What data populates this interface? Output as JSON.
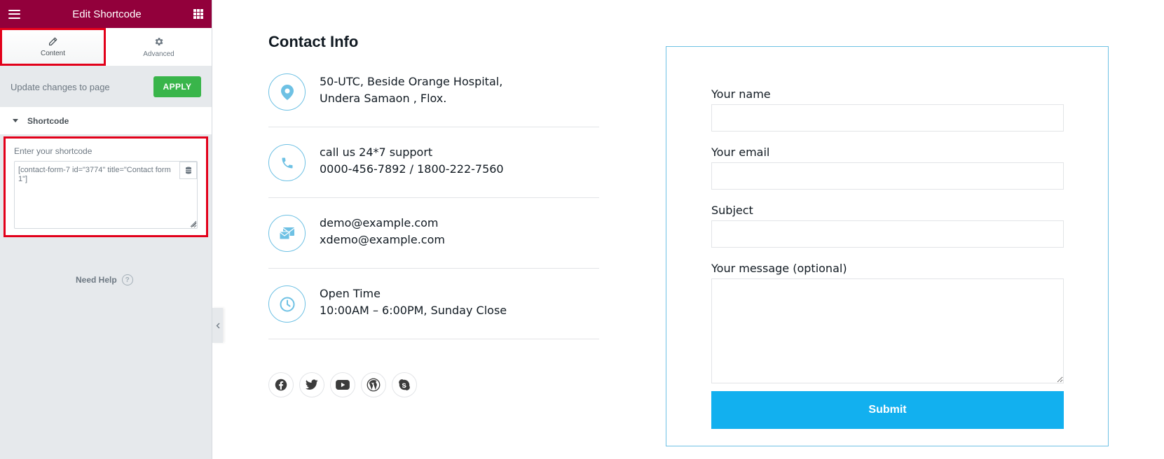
{
  "sidebar": {
    "header_title": "Edit Shortcode",
    "tabs": [
      {
        "label": "Content"
      },
      {
        "label": "Advanced"
      }
    ],
    "apply_text": "Update changes to page",
    "apply_label": "APPLY",
    "section_title": "Shortcode",
    "control_label": "Enter your shortcode",
    "shortcode_value": "[contact-form-7 id=\"3774\" title=\"Contact form 1\"]",
    "need_help": "Need Help",
    "help_glyph": "?"
  },
  "contact": {
    "title": "Contact Info",
    "items": [
      {
        "icon": "map-pin-icon",
        "line1": "50-UTC, Beside Orange Hospital,",
        "line2": "Undera Samaon , Flox."
      },
      {
        "icon": "phone-icon",
        "line1": "call us 24*7 support",
        "line2": "0000-456-7892 / 1800-222-7560"
      },
      {
        "icon": "envelope-icon",
        "line1": "demo@example.com",
        "line2": "xdemo@example.com"
      },
      {
        "icon": "clock-icon",
        "line1": "Open Time",
        "line2": "10:00AM – 6:00PM, Sunday Close"
      }
    ],
    "socials": [
      "facebook-icon",
      "twitter-icon",
      "youtube-icon",
      "wordpress-icon",
      "skype-icon"
    ]
  },
  "form": {
    "name_label": "Your name",
    "email_label": "Your email",
    "subject_label": "Subject",
    "message_label": "Your message (optional)",
    "submit_label": "Submit"
  },
  "colors": {
    "header": "#92003b",
    "apply": "#39b54a",
    "highlight": "#e2001a",
    "accent": "#6ec1e4",
    "submit": "#12b0ef"
  }
}
